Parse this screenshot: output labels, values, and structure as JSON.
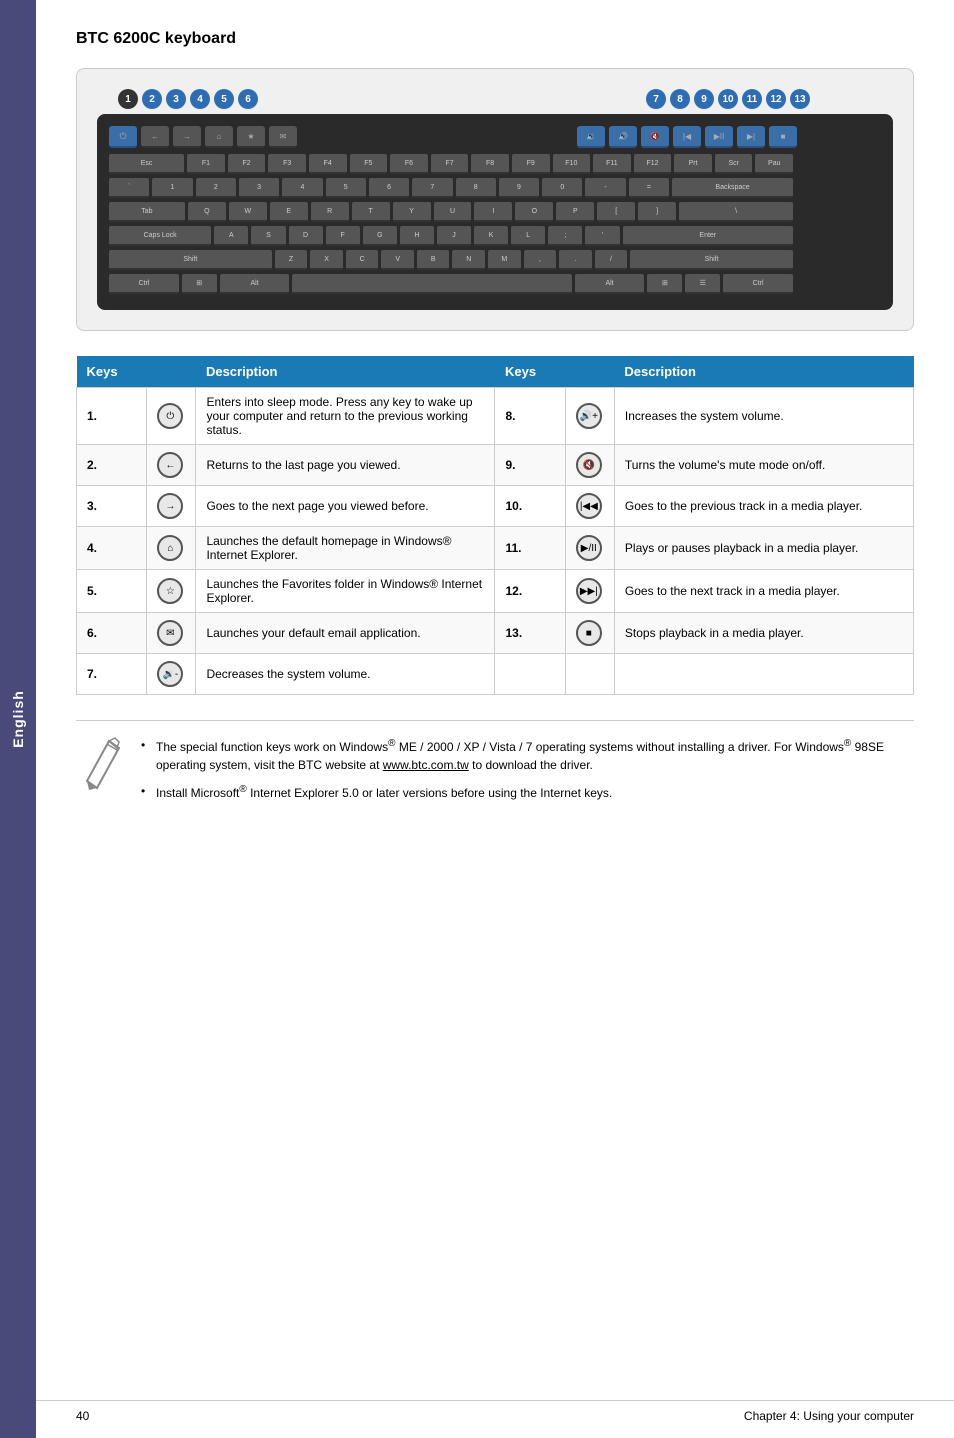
{
  "sidebar": {
    "label": "English"
  },
  "page": {
    "title": "BTC 6200C keyboard",
    "footer_page": "40",
    "footer_chapter": "Chapter 4: Using your computer"
  },
  "keyboard_diagram": {
    "numbers_left": [
      "1",
      "2",
      "3",
      "4",
      "5",
      "6"
    ],
    "numbers_right": [
      "7",
      "8",
      "9",
      "10",
      "11",
      "12",
      "13"
    ]
  },
  "table": {
    "col1_header": "Keys",
    "col2_header": "Description",
    "col3_header": "Keys",
    "col4_header": "Description",
    "rows": [
      {
        "left_num": "1.",
        "left_icon": "⏻",
        "left_desc": "Enters into sleep mode. Press any key to wake up your computer and return to the previous working status.",
        "right_num": "8.",
        "right_icon": "🔊+",
        "right_desc": "Increases the system volume."
      },
      {
        "left_num": "2.",
        "left_icon": "←",
        "left_desc": "Returns to the last page you viewed.",
        "right_num": "9.",
        "right_icon": "🔇",
        "right_desc": "Turns the volume's mute mode on/off."
      },
      {
        "left_num": "3.",
        "left_icon": "→",
        "left_desc": "Goes to the next page you viewed before.",
        "right_num": "10.",
        "right_icon": "|◀◀",
        "right_desc": "Goes to the previous track in a media player."
      },
      {
        "left_num": "4.",
        "left_icon": "⌂",
        "left_desc": "Launches the default homepage in Windows® Internet Explorer.",
        "right_num": "11.",
        "right_icon": "▶/II",
        "right_desc": "Plays or pauses playback in a media player."
      },
      {
        "left_num": "5.",
        "left_icon": "☆",
        "left_desc": "Launches the Favorites folder in Windows® Internet Explorer.",
        "right_num": "12.",
        "right_icon": "▶▶|",
        "right_desc": "Goes to the next track in a media player."
      },
      {
        "left_num": "6.",
        "left_icon": "✉",
        "left_desc": "Launches your default email application.",
        "right_num": "13.",
        "right_icon": "■",
        "right_desc": "Stops playback in a media player."
      },
      {
        "left_num": "7.",
        "left_icon": "🔉-",
        "left_desc": "Decreases the system volume.",
        "right_num": "",
        "right_icon": "",
        "right_desc": ""
      }
    ]
  },
  "notes": [
    "The special function keys work on Windows® ME / 2000 / XP / Vista / 7 operating systems without installing a driver. For Windows® 98SE operating system, visit the BTC website at www.btc.com.tw to download the driver.",
    "Install Microsoft® Internet Explorer 5.0 or later versions before using the Internet keys."
  ],
  "note_link": "www.btc.com.tw"
}
